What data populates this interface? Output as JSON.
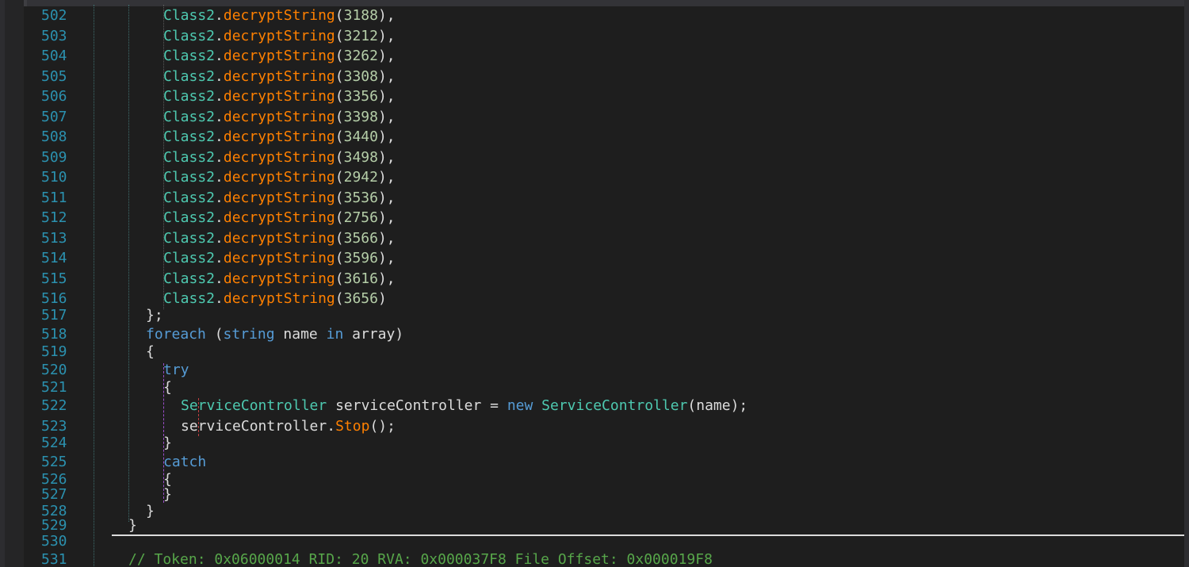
{
  "colors": {
    "background": "#1e1e1e",
    "line_number": "#2b91af",
    "type": "#4ec9b0",
    "method": "#ff8000",
    "number": "#b5cea8",
    "keyword": "#569cd6",
    "comment": "#57a64a",
    "text": "#dcdcdc"
  },
  "lines": [
    {
      "n": "502",
      "indent": 5,
      "tokens": [
        {
          "t": "Class2",
          "c": "cls"
        },
        {
          "t": ".",
          "c": "p"
        },
        {
          "t": "decryptString",
          "c": "mth"
        },
        {
          "t": "(",
          "c": "p"
        },
        {
          "t": "3188",
          "c": "num"
        },
        {
          "t": "),",
          "c": "p"
        }
      ]
    },
    {
      "n": "503",
      "indent": 5,
      "tokens": [
        {
          "t": "Class2",
          "c": "cls"
        },
        {
          "t": ".",
          "c": "p"
        },
        {
          "t": "decryptString",
          "c": "mth"
        },
        {
          "t": "(",
          "c": "p"
        },
        {
          "t": "3212",
          "c": "num"
        },
        {
          "t": "),",
          "c": "p"
        }
      ]
    },
    {
      "n": "504",
      "indent": 5,
      "tokens": [
        {
          "t": "Class2",
          "c": "cls"
        },
        {
          "t": ".",
          "c": "p"
        },
        {
          "t": "decryptString",
          "c": "mth"
        },
        {
          "t": "(",
          "c": "p"
        },
        {
          "t": "3262",
          "c": "num"
        },
        {
          "t": "),",
          "c": "p"
        }
      ]
    },
    {
      "n": "505",
      "indent": 5,
      "tokens": [
        {
          "t": "Class2",
          "c": "cls"
        },
        {
          "t": ".",
          "c": "p"
        },
        {
          "t": "decryptString",
          "c": "mth"
        },
        {
          "t": "(",
          "c": "p"
        },
        {
          "t": "3308",
          "c": "num"
        },
        {
          "t": "),",
          "c": "p"
        }
      ]
    },
    {
      "n": "506",
      "indent": 5,
      "tokens": [
        {
          "t": "Class2",
          "c": "cls"
        },
        {
          "t": ".",
          "c": "p"
        },
        {
          "t": "decryptString",
          "c": "mth"
        },
        {
          "t": "(",
          "c": "p"
        },
        {
          "t": "3356",
          "c": "num"
        },
        {
          "t": "),",
          "c": "p"
        }
      ]
    },
    {
      "n": "507",
      "indent": 5,
      "tokens": [
        {
          "t": "Class2",
          "c": "cls"
        },
        {
          "t": ".",
          "c": "p"
        },
        {
          "t": "decryptString",
          "c": "mth"
        },
        {
          "t": "(",
          "c": "p"
        },
        {
          "t": "3398",
          "c": "num"
        },
        {
          "t": "),",
          "c": "p"
        }
      ]
    },
    {
      "n": "508",
      "indent": 5,
      "tokens": [
        {
          "t": "Class2",
          "c": "cls"
        },
        {
          "t": ".",
          "c": "p"
        },
        {
          "t": "decryptString",
          "c": "mth"
        },
        {
          "t": "(",
          "c": "p"
        },
        {
          "t": "3440",
          "c": "num"
        },
        {
          "t": "),",
          "c": "p"
        }
      ]
    },
    {
      "n": "509",
      "indent": 5,
      "tokens": [
        {
          "t": "Class2",
          "c": "cls"
        },
        {
          "t": ".",
          "c": "p"
        },
        {
          "t": "decryptString",
          "c": "mth"
        },
        {
          "t": "(",
          "c": "p"
        },
        {
          "t": "3498",
          "c": "num"
        },
        {
          "t": "),",
          "c": "p"
        }
      ]
    },
    {
      "n": "510",
      "indent": 5,
      "tokens": [
        {
          "t": "Class2",
          "c": "cls"
        },
        {
          "t": ".",
          "c": "p"
        },
        {
          "t": "decryptString",
          "c": "mth"
        },
        {
          "t": "(",
          "c": "p"
        },
        {
          "t": "2942",
          "c": "num"
        },
        {
          "t": "),",
          "c": "p"
        }
      ]
    },
    {
      "n": "511",
      "indent": 5,
      "tokens": [
        {
          "t": "Class2",
          "c": "cls"
        },
        {
          "t": ".",
          "c": "p"
        },
        {
          "t": "decryptString",
          "c": "mth"
        },
        {
          "t": "(",
          "c": "p"
        },
        {
          "t": "3536",
          "c": "num"
        },
        {
          "t": "),",
          "c": "p"
        }
      ]
    },
    {
      "n": "512",
      "indent": 5,
      "tokens": [
        {
          "t": "Class2",
          "c": "cls"
        },
        {
          "t": ".",
          "c": "p"
        },
        {
          "t": "decryptString",
          "c": "mth"
        },
        {
          "t": "(",
          "c": "p"
        },
        {
          "t": "2756",
          "c": "num"
        },
        {
          "t": "),",
          "c": "p"
        }
      ]
    },
    {
      "n": "513",
      "indent": 5,
      "tokens": [
        {
          "t": "Class2",
          "c": "cls"
        },
        {
          "t": ".",
          "c": "p"
        },
        {
          "t": "decryptString",
          "c": "mth"
        },
        {
          "t": "(",
          "c": "p"
        },
        {
          "t": "3566",
          "c": "num"
        },
        {
          "t": "),",
          "c": "p"
        }
      ]
    },
    {
      "n": "514",
      "indent": 5,
      "tokens": [
        {
          "t": "Class2",
          "c": "cls"
        },
        {
          "t": ".",
          "c": "p"
        },
        {
          "t": "decryptString",
          "c": "mth"
        },
        {
          "t": "(",
          "c": "p"
        },
        {
          "t": "3596",
          "c": "num"
        },
        {
          "t": "),",
          "c": "p"
        }
      ]
    },
    {
      "n": "515",
      "indent": 5,
      "tokens": [
        {
          "t": "Class2",
          "c": "cls"
        },
        {
          "t": ".",
          "c": "p"
        },
        {
          "t": "decryptString",
          "c": "mth"
        },
        {
          "t": "(",
          "c": "p"
        },
        {
          "t": "3616",
          "c": "num"
        },
        {
          "t": "),",
          "c": "p"
        }
      ]
    },
    {
      "n": "516",
      "indent": 5,
      "tokens": [
        {
          "t": "Class2",
          "c": "cls"
        },
        {
          "t": ".",
          "c": "p"
        },
        {
          "t": "decryptString",
          "c": "mth"
        },
        {
          "t": "(",
          "c": "p"
        },
        {
          "t": "3656",
          "c": "num"
        },
        {
          "t": ")",
          "c": "p"
        }
      ]
    },
    {
      "n": "517",
      "indent": 4,
      "tokens": [
        {
          "t": "};",
          "c": "p"
        }
      ]
    },
    {
      "n": "518",
      "indent": 4,
      "tokens": [
        {
          "t": "foreach",
          "c": "kw"
        },
        {
          "t": " (",
          "c": "p"
        },
        {
          "t": "string",
          "c": "kw"
        },
        {
          "t": " name ",
          "c": "p"
        },
        {
          "t": "in",
          "c": "kw"
        },
        {
          "t": " array)",
          "c": "p"
        }
      ]
    },
    {
      "n": "519",
      "indent": 4,
      "tokens": [
        {
          "t": "{",
          "c": "p"
        }
      ]
    },
    {
      "n": "520",
      "indent": 5,
      "tokens": [
        {
          "t": "try",
          "c": "kw"
        }
      ]
    },
    {
      "n": "521",
      "indent": 5,
      "tokens": [
        {
          "t": "{",
          "c": "p"
        }
      ]
    },
    {
      "n": "522",
      "indent": 6,
      "tokens": [
        {
          "t": "ServiceController",
          "c": "cls"
        },
        {
          "t": " serviceController = ",
          "c": "p"
        },
        {
          "t": "new",
          "c": "kw"
        },
        {
          "t": " ",
          "c": "p"
        },
        {
          "t": "ServiceController",
          "c": "cls"
        },
        {
          "t": "(name);",
          "c": "p"
        }
      ]
    },
    {
      "n": "523",
      "indent": 6,
      "tokens": [
        {
          "t": "serviceController.",
          "c": "p"
        },
        {
          "t": "Stop",
          "c": "mth"
        },
        {
          "t": "();",
          "c": "p"
        }
      ]
    },
    {
      "n": "524",
      "indent": 5,
      "tokens": [
        {
          "t": "}",
          "c": "p"
        }
      ]
    },
    {
      "n": "525",
      "indent": 5,
      "tokens": [
        {
          "t": "catch",
          "c": "kw"
        }
      ]
    },
    {
      "n": "526",
      "indent": 5,
      "tokens": [
        {
          "t": "{",
          "c": "p"
        }
      ]
    },
    {
      "n": "527",
      "indent": 5,
      "tokens": [
        {
          "t": "}",
          "c": "p"
        }
      ]
    },
    {
      "n": "528",
      "indent": 4,
      "tokens": [
        {
          "t": "}",
          "c": "p"
        }
      ]
    },
    {
      "n": "529",
      "indent": 3,
      "tokens": [
        {
          "t": "}",
          "c": "p"
        }
      ]
    },
    {
      "n": "530",
      "indent": 0,
      "tokens": []
    },
    {
      "n": "531",
      "indent": 3,
      "tokens": [
        {
          "t": "// Token: 0x06000014 RID: 20 RVA: 0x000037F8 File Offset: 0x000019F8",
          "c": "cm"
        }
      ]
    }
  ]
}
